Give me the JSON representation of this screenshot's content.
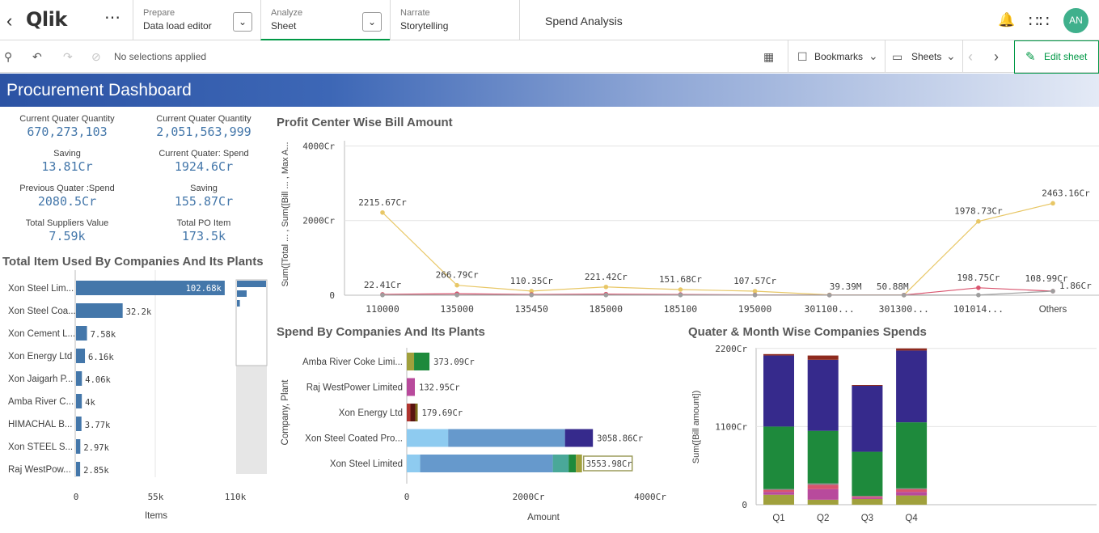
{
  "nav": {
    "prepare": {
      "label": "Prepare",
      "value": "Data load editor"
    },
    "analyze": {
      "label": "Analyze",
      "value": "Sheet"
    },
    "narrate": {
      "label": "Narrate",
      "value": "Storytelling"
    },
    "app_title": "Spend Analysis",
    "avatar": "AN",
    "logo": "Qlik"
  },
  "toolbar": {
    "selections": "No selections applied",
    "bookmarks": "Bookmarks",
    "sheets": "Sheets",
    "edit": "Edit sheet"
  },
  "banner": {
    "title": "Procurement Dashboard"
  },
  "kpis": [
    {
      "label": "Current Quater Quantity",
      "value": "670,273,103"
    },
    {
      "label": "Current Quater Quantity",
      "value": "2,051,563,999"
    },
    {
      "label": "Saving",
      "value": "13.81Cr"
    },
    {
      "label": "Current Quater: Spend",
      "value": "1924.6Cr"
    },
    {
      "label": "Previous Quater :Spend",
      "value": "2080.5Cr"
    },
    {
      "label": "Saving",
      "value": "155.87Cr"
    },
    {
      "label": "Total Suppliers Value",
      "value": "7.59k"
    },
    {
      "label": "Total PO Item",
      "value": "173.5k"
    }
  ],
  "colors": {
    "accent": "#009845",
    "banner": "#2c53a4",
    "kpi_value": "#4477aa",
    "bar": "#4477aa"
  },
  "chart_data": [
    {
      "id": "items",
      "type": "bar",
      "orientation": "horizontal",
      "title": "Total Item Used By Companies And Its Plants",
      "xlabel": "Items",
      "categories": [
        "Xon Steel Lim...",
        "Xon Steel Coa...",
        "Xon Cement L...",
        "Xon Energy Ltd",
        "Xon Jaigarh P...",
        "Amba River C...",
        "HIMACHAL B...",
        "Xon STEEL S...",
        "Raj WestPow..."
      ],
      "values": [
        102680,
        32200,
        7580,
        6160,
        4060,
        4000,
        3770,
        2970,
        2850
      ],
      "value_labels": [
        "102.68k",
        "32.2k",
        "7.58k",
        "6.16k",
        "4.06k",
        "4k",
        "3.77k",
        "2.97k",
        "2.85k"
      ],
      "xlim": [
        0,
        123000
      ],
      "xticks": [
        {
          "v": 0,
          "label": "0"
        },
        {
          "v": 55000,
          "label": "55k"
        },
        {
          "v": 110000,
          "label": "110k"
        }
      ]
    },
    {
      "id": "profit",
      "type": "line",
      "title": "Profit Center Wise Bill Amount",
      "ylabel": "Sum([Total ... , Sum([Bill ... , Max A...",
      "categories": [
        "110000",
        "135000",
        "135450",
        "185000",
        "185100",
        "195000",
        "301100...",
        "301300...",
        "101014...",
        "Others"
      ],
      "ylim": [
        0,
        4400
      ],
      "yticks": [
        {
          "v": 0,
          "label": "0"
        },
        {
          "v": 2000,
          "label": "2000Cr"
        },
        {
          "v": 4000,
          "label": "4000Cr"
        }
      ],
      "series": [
        {
          "color": "#e8c766",
          "values": [
            2215.67,
            266.79,
            110.35,
            221.42,
            151.68,
            107.57,
            10,
            5,
            1978.73,
            2463.16
          ]
        },
        {
          "color": "#d9546e",
          "values": [
            22.41,
            40,
            20,
            30,
            20,
            10,
            3.94,
            5.09,
            198.75,
            108.99
          ]
        },
        {
          "color": "#9e9e9e",
          "values": [
            5,
            5,
            5,
            5,
            5,
            5,
            2,
            2,
            5,
            108.99
          ]
        }
      ],
      "annotations": [
        {
          "i": 0,
          "v": 2215.67,
          "label": "2215.67Cr"
        },
        {
          "i": 0,
          "v": 22.41,
          "label": "22.41Cr"
        },
        {
          "i": 1,
          "v": 266.79,
          "label": "266.79Cr"
        },
        {
          "i": 2,
          "v": 110.35,
          "label": "110.35Cr"
        },
        {
          "i": 3,
          "v": 221.42,
          "label": "221.42Cr"
        },
        {
          "i": 4,
          "v": 151.68,
          "label": "151.68Cr"
        },
        {
          "i": 5,
          "v": 107.57,
          "label": "107.57Cr"
        },
        {
          "i": 6,
          "v": 3.94,
          "label": "39.39M"
        },
        {
          "i": 7,
          "v": 5.09,
          "label": "50.88M"
        },
        {
          "i": 8,
          "v": 1978.73,
          "label": "1978.73Cr"
        },
        {
          "i": 8,
          "v": 198.75,
          "label": "198.75Cr"
        },
        {
          "i": 9,
          "v": 2463.16,
          "label": "2463.16Cr"
        },
        {
          "i": 9,
          "v": 108.99,
          "label": "108.99Cr"
        },
        {
          "i": 9,
          "v": 1.86,
          "label": "1.86Cr"
        }
      ]
    },
    {
      "id": "spend",
      "type": "bar",
      "orientation": "horizontal",
      "stacked": true,
      "title": "Spend By Companies And Its Plants",
      "xlabel": "Amount",
      "ylabel": "Company, Plant",
      "xlim": [
        0,
        4400
      ],
      "xticks": [
        {
          "v": 0,
          "label": "0"
        },
        {
          "v": 2000,
          "label": "2000Cr"
        },
        {
          "v": 4000,
          "label": "4000Cr"
        }
      ],
      "rows": [
        {
          "name": "Amba River Coke Limi...",
          "total_label": "373.09Cr",
          "segments": [
            {
              "v": 120,
              "color": "#a0a03c"
            },
            {
              "v": 253.09,
              "color": "#1e8a3c"
            }
          ]
        },
        {
          "name": "Raj WestPower Limited",
          "total_label": "132.95Cr",
          "segments": [
            {
              "v": 132.95,
              "color": "#b84a9c"
            }
          ]
        },
        {
          "name": "Xon Energy Ltd",
          "total_label": "179.69Cr",
          "segments": [
            {
              "v": 60,
              "color": "#b0352f"
            },
            {
              "v": 80,
              "color": "#5a1410"
            },
            {
              "v": 39.69,
              "color": "#7a6a1a"
            }
          ]
        },
        {
          "name": "Xon Steel Coated Pro...",
          "total_label": "3058.86Cr",
          "segments": [
            {
              "v": 680,
              "color": "#8ecbf0"
            },
            {
              "v": 1920,
              "color": "#6699cc"
            },
            {
              "v": 458.86,
              "color": "#362a8c"
            }
          ]
        },
        {
          "name": "Xon Steel Limited",
          "total_label": "3553.98Cr",
          "segments": [
            {
              "v": 220,
              "color": "#8ecbf0"
            },
            {
              "v": 2180,
              "color": "#6699cc"
            },
            {
              "v": 260,
              "color": "#4aa899"
            },
            {
              "v": 120,
              "color": "#1e8a3c"
            },
            {
              "v": 100,
              "color": "#a0a03c"
            }
          ]
        }
      ]
    },
    {
      "id": "quarter",
      "type": "bar",
      "stacked": true,
      "title": "Quater & Month Wise Companies Spends",
      "ylabel": "Sum([Bill amount])",
      "categories": [
        "Q1",
        "Q2",
        "Q3",
        "Q4"
      ],
      "ylim": [
        0,
        2300
      ],
      "yticks": [
        {
          "v": 0,
          "label": "0"
        },
        {
          "v": 1100,
          "label": "1100Cr"
        },
        {
          "v": 2200,
          "label": "2200Cr"
        }
      ],
      "series": [
        {
          "color": "#a0a03c",
          "values": [
            140,
            70,
            80,
            130
          ]
        },
        {
          "color": "#b84a9c",
          "values": [
            40,
            150,
            20,
            50
          ]
        },
        {
          "color": "#d9546e",
          "values": [
            30,
            60,
            20,
            40
          ]
        },
        {
          "color": "#8a8a8a",
          "values": [
            10,
            20,
            5,
            10
          ]
        },
        {
          "color": "#1e8a3c",
          "values": [
            880,
            740,
            620,
            930
          ]
        },
        {
          "color": "#362a8c",
          "values": [
            1000,
            1000,
            930,
            1010
          ]
        },
        {
          "color": "#8e2a1e",
          "values": [
            20,
            60,
            10,
            30
          ]
        }
      ]
    }
  ]
}
